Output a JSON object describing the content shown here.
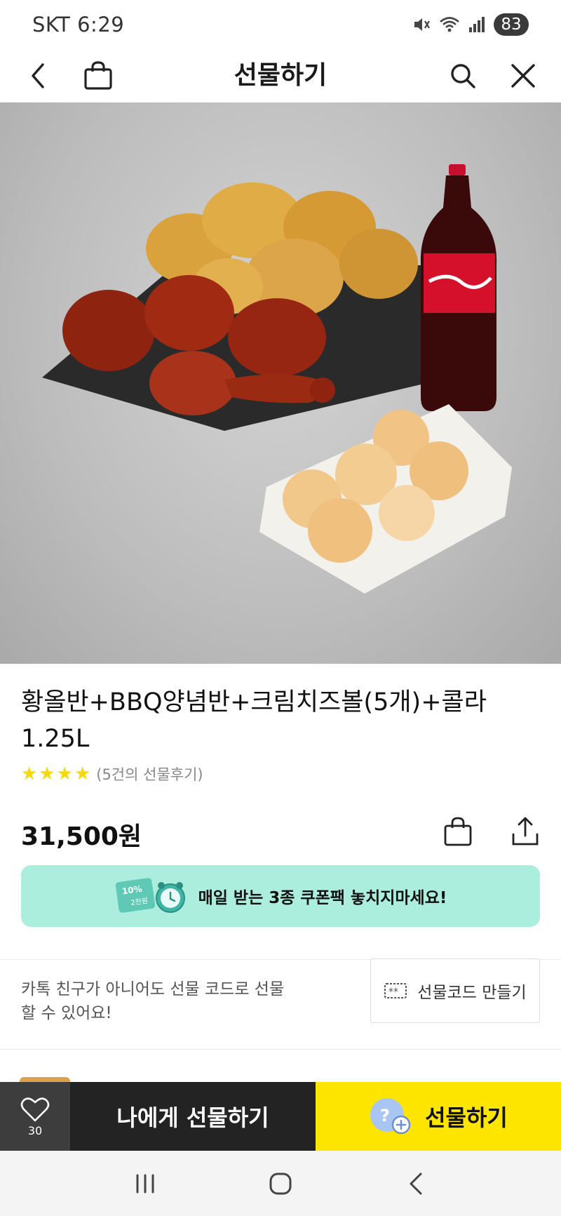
{
  "status_bar": {
    "carrier_time": "SKT 6:29",
    "battery": "83"
  },
  "nav": {
    "title": "선물하기"
  },
  "product": {
    "title": "황올반+BBQ양념반+크림치즈볼(5개)+콜라1.25L",
    "rating_stars": 4,
    "review_count": "(5건의 선물후기)",
    "price": "31,500원"
  },
  "coupon_banner": {
    "text": "매일 받는 3종 쿠폰팩 놓치지마세요!",
    "badge_top": "10%",
    "badge_bottom": "2천원"
  },
  "gift_code": {
    "description": "카톡 친구가 아니어도 선물 코드로 선물 할 수 있어요!",
    "button_label": "선물코드 만들기"
  },
  "bottom_bar": {
    "like_count": "30",
    "gift_self_label": "나에게 선물하기",
    "gift_friend_label": "선물하기"
  },
  "colors": {
    "accent_yellow": "#fee500",
    "coupon_mint": "#abeede",
    "star_yellow": "#f5d90a",
    "dark_button": "#232323"
  },
  "icons": {
    "back": "chevron-left-icon",
    "shop": "shopping-bag-icon",
    "search": "search-icon",
    "close": "close-icon",
    "wish": "shopping-bag-icon",
    "share": "share-icon",
    "like": "heart-icon",
    "gift_code": "gift-code-ticket-icon",
    "gift_friend": "gift-friend-icon"
  }
}
